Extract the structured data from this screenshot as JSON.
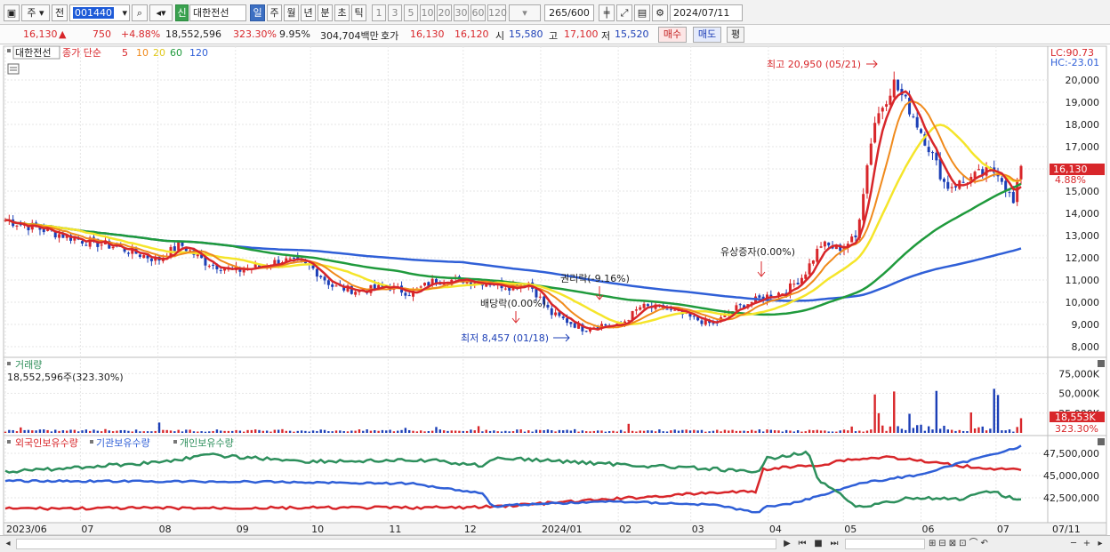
{
  "toolbar": {
    "type_label": "주",
    "prev_label": "전",
    "code": "001440",
    "stock_name": "대한전선",
    "badge_label": "신",
    "periods": [
      "일",
      "주",
      "월",
      "년",
      "분",
      "초",
      "틱"
    ],
    "active_period": "일",
    "intervals": [
      "1",
      "3",
      "5",
      "10",
      "20",
      "30",
      "60",
      "120"
    ],
    "count": "265",
    "count_total": "/600",
    "date": "2024/07/11"
  },
  "quote": {
    "price": "16,130",
    "arrow": "▲",
    "change": "750",
    "change_pct": "+4.88%",
    "volume": "18,552,596",
    "volume_pct": "323.30%",
    "turnover": "9.95%",
    "amount": "304,704백만",
    "ask_label": "호가",
    "ask": "16,130",
    "bid": "16,120",
    "open_label": "시",
    "open": "15,580",
    "high_label": "고",
    "high": "17,100",
    "low_label": "저",
    "low": "15,520",
    "buy_label": "매수",
    "sell_label": "매도",
    "eval_label": "평"
  },
  "colors": {
    "up": "#d8262a",
    "down": "#1c3fb6",
    "ma5": "#d8262a",
    "ma10": "#f08a1c",
    "ma20": "#f5e52a",
    "ma60": "#1f9a3c",
    "ma120": "#2f5fd7",
    "foreign": "#d8262a",
    "institution": "#2f5fd7",
    "individual": "#2d8f5c"
  },
  "chart_data": [
    {
      "type": "candlestick",
      "title": "대한전선",
      "legend": {
        "label": "종가 단순",
        "periods": [
          "5",
          "10",
          "20",
          "60",
          "120"
        ]
      },
      "corner_labels": {
        "lc": "LC:90.73",
        "hc": "HC:-23.01"
      },
      "price_axis": [
        "20,000",
        "19,000",
        "18,000",
        "17,000",
        "16,000",
        "15,000",
        "14,000",
        "13,000",
        "12,000",
        "11,000",
        "10,000",
        "9,000",
        "8,000"
      ],
      "ylim": [
        7600,
        21400
      ],
      "current_price_label": "16,130",
      "current_change_label": "4.88%",
      "x_labels": [
        "2023/06",
        "07",
        "08",
        "09",
        "10",
        "11",
        "12",
        "2024/01",
        "02",
        "03",
        "04",
        "05",
        "06",
        "07",
        "07/11"
      ],
      "annotations": [
        {
          "text": "최고 20,950 (05/21)",
          "date": "2024-05-21",
          "value": 20950
        },
        {
          "text": "최저 8,457 (01/18)",
          "date": "2024-01-18",
          "value": 8457
        },
        {
          "text": "권리락(-9.16%)",
          "date": "2024-02-01"
        },
        {
          "text": "배당락(0.00%)",
          "date": "2023-12-27"
        },
        {
          "text": "유상증자(0.00%)",
          "date": "2024-04-08"
        }
      ],
      "close_series": [
        [
          "2023-06-01",
          13700
        ],
        [
          "2023-06-15",
          13300
        ],
        [
          "2023-07-01",
          12800
        ],
        [
          "2023-07-15",
          12500
        ],
        [
          "2023-08-01",
          11900
        ],
        [
          "2023-08-10",
          12600
        ],
        [
          "2023-08-20",
          11800
        ],
        [
          "2023-09-01",
          11400
        ],
        [
          "2023-09-10",
          11600
        ],
        [
          "2023-09-20",
          11900
        ],
        [
          "2023-10-01",
          11600
        ],
        [
          "2023-10-10",
          10700
        ],
        [
          "2023-10-20",
          10500
        ],
        [
          "2023-11-01",
          10700
        ],
        [
          "2023-11-10",
          10400
        ],
        [
          "2023-11-20",
          11000
        ],
        [
          "2023-12-01",
          11000
        ],
        [
          "2023-12-10",
          10900
        ],
        [
          "2023-12-20",
          10700
        ],
        [
          "2023-12-27",
          10900
        ],
        [
          "2024-01-05",
          9500
        ],
        [
          "2024-01-18",
          8800
        ],
        [
          "2024-01-25",
          9000
        ],
        [
          "2024-02-01",
          8900
        ],
        [
          "2024-02-10",
          9800
        ],
        [
          "2024-02-20",
          9700
        ],
        [
          "2024-03-01",
          9300
        ],
        [
          "2024-03-10",
          9000
        ],
        [
          "2024-03-20",
          9800
        ],
        [
          "2024-04-01",
          10300
        ],
        [
          "2024-04-08",
          10500
        ],
        [
          "2024-04-15",
          11200
        ],
        [
          "2024-04-22",
          12600
        ],
        [
          "2024-04-29",
          12400
        ],
        [
          "2024-05-06",
          12900
        ],
        [
          "2024-05-13",
          18000
        ],
        [
          "2024-05-21",
          19900
        ],
        [
          "2024-05-28",
          18600
        ],
        [
          "2024-06-04",
          17000
        ],
        [
          "2024-06-11",
          15200
        ],
        [
          "2024-06-18",
          15400
        ],
        [
          "2024-06-25",
          15800
        ],
        [
          "2024-07-02",
          15900
        ],
        [
          "2024-07-08",
          14400
        ],
        [
          "2024-07-11",
          16130
        ]
      ],
      "ma_series": [
        {
          "name": "120",
          "values": [
            13700,
            13500,
            13200,
            13000,
            12800,
            12600,
            12400,
            12200,
            12000,
            11800,
            11500,
            11200,
            11000,
            10800,
            10500,
            10300,
            10100,
            10000,
            10000,
            10300,
            10900,
            11600,
            12100,
            12500,
            12700
          ]
        },
        {
          "name": "60",
          "values": [
            13700,
            13400,
            12900,
            12500,
            12200,
            11900,
            11600,
            11400,
            11200,
            11000,
            10800,
            10500,
            10000,
            9700,
            9500,
            9500,
            9800,
            10400,
            11300,
            12600,
            13900,
            14800,
            15300,
            15600
          ]
        }
      ]
    },
    {
      "type": "bar",
      "title": "거래량",
      "current_label": "18,552,596주(323.30%)",
      "axis": [
        "75,000K",
        "50,000K",
        "25,000K"
      ],
      "current_value_label": "18,553K",
      "current_pct_label": "323.30%",
      "ylim": [
        0,
        90000
      ]
    },
    {
      "type": "line",
      "series": [
        {
          "name": "외국인보유수량"
        },
        {
          "name": "기관보유수량"
        },
        {
          "name": "개인보유수량"
        }
      ],
      "axis": [
        "47,500,000",
        "45,000,000",
        "42,500,000"
      ]
    }
  ],
  "scrollbar": {
    "controls": [
      "▶",
      "⏮",
      "■",
      "⏭",
      "─",
      "+"
    ]
  }
}
